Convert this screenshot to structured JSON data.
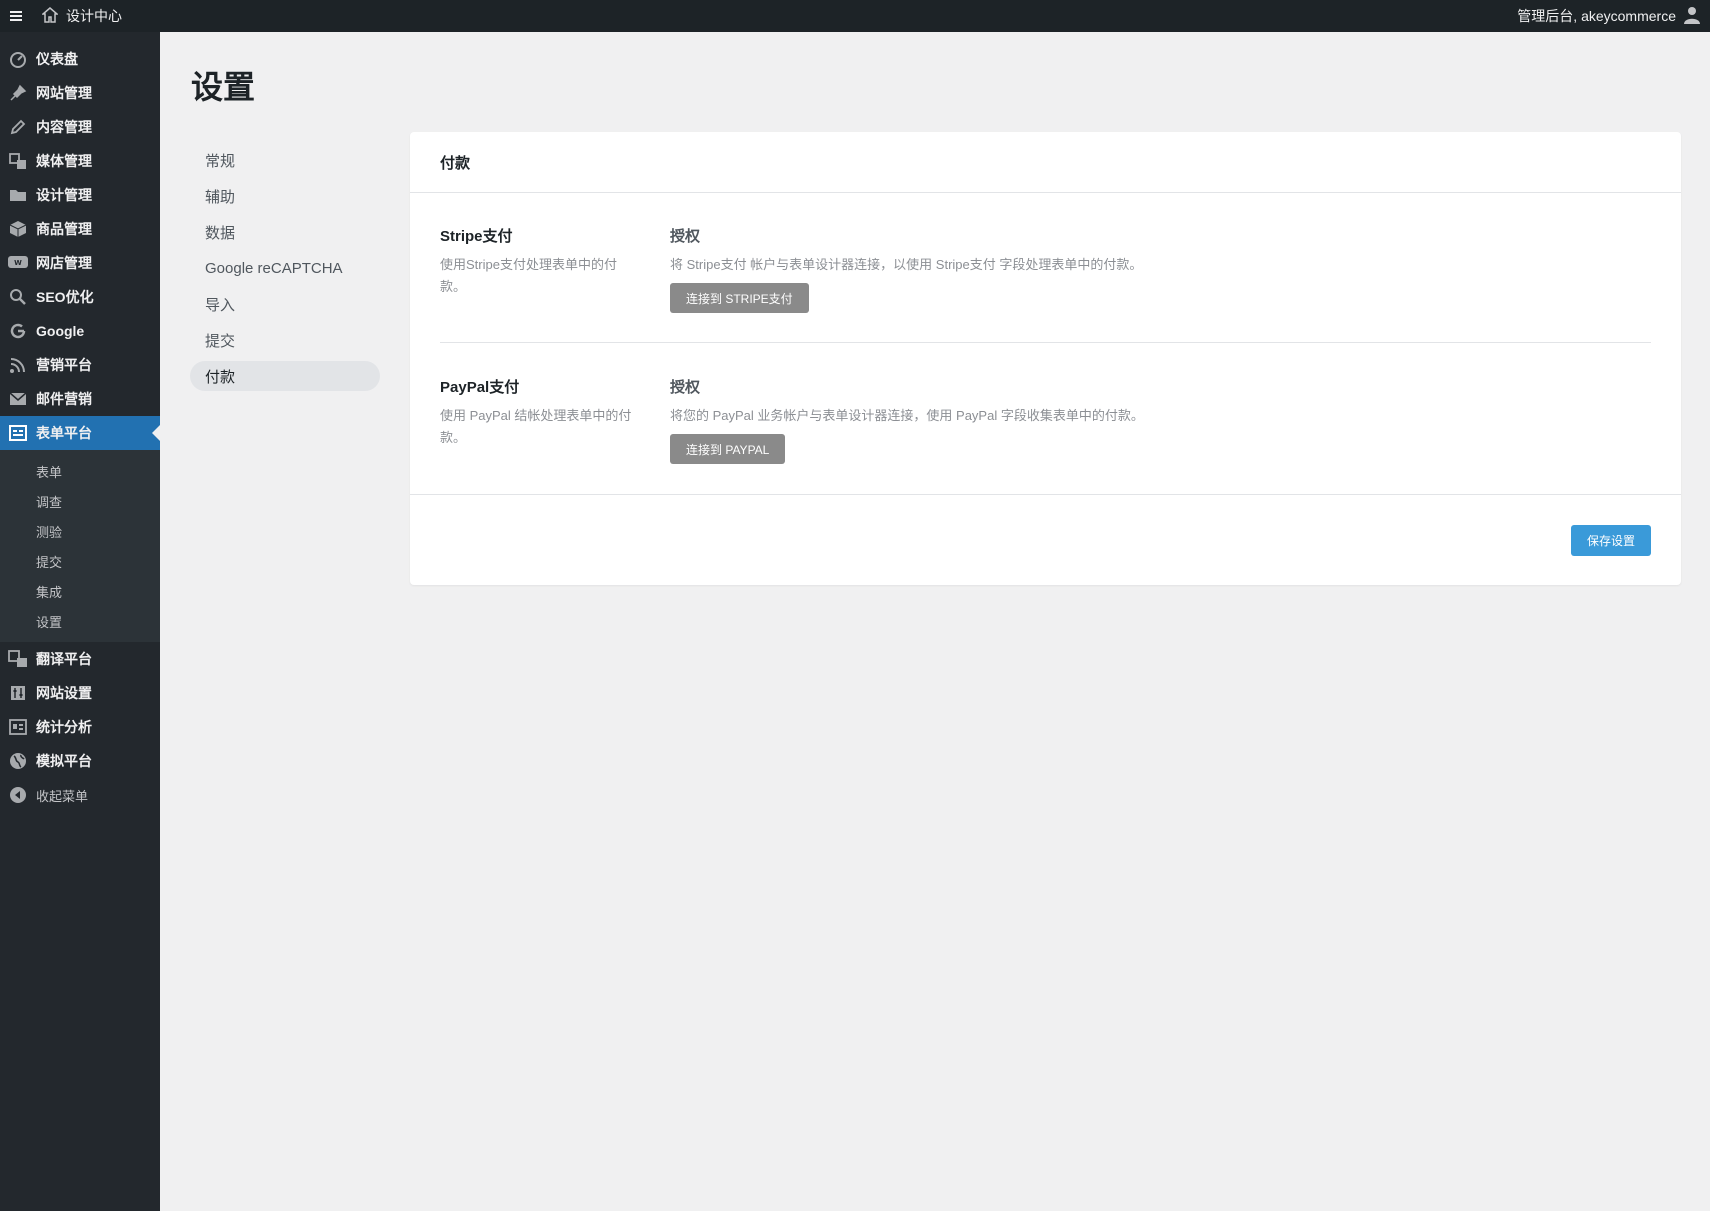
{
  "adminbar": {
    "site_title": "设计中心",
    "greeting": "管理后台, akeycommerce"
  },
  "sidebar": {
    "items": [
      {
        "label": "仪表盘",
        "icon": "dashboard-icon"
      },
      {
        "label": "网站管理",
        "icon": "pin-icon"
      },
      {
        "label": "内容管理",
        "icon": "pencil-icon"
      },
      {
        "label": "媒体管理",
        "icon": "media-icon"
      },
      {
        "label": "设计管理",
        "icon": "folder-icon"
      },
      {
        "label": "商品管理",
        "icon": "box-icon"
      },
      {
        "label": "网店管理",
        "icon": "woo-icon"
      },
      {
        "label": "SEO优化",
        "icon": "search-icon"
      },
      {
        "label": "Google",
        "icon": "google-icon"
      },
      {
        "label": "营销平台",
        "icon": "rss-icon"
      },
      {
        "label": "邮件营销",
        "icon": "mail-icon"
      },
      {
        "label": "表单平台",
        "icon": "form-icon",
        "active": true
      }
    ],
    "submenu": [
      "表单",
      "调查",
      "测验",
      "提交",
      "集成",
      "设置"
    ],
    "items_after": [
      {
        "label": "翻译平台",
        "icon": "translate-icon"
      },
      {
        "label": "网站设置",
        "icon": "settings-icon"
      },
      {
        "label": "统计分析",
        "icon": "analytics-icon"
      },
      {
        "label": "模拟平台",
        "icon": "globe-icon"
      }
    ],
    "collapse_label": "收起菜单"
  },
  "page": {
    "title": "设置"
  },
  "subnav": {
    "items": [
      "常规",
      "辅助",
      "数据",
      "Google reCAPTCHA",
      "导入",
      "提交",
      "付款"
    ],
    "active": "付款"
  },
  "card": {
    "header": "付款",
    "stripe": {
      "title": "Stripe支付",
      "desc": "使用Stripe支付处理表单中的付款。",
      "auth_title": "授权",
      "auth_desc": "将 Stripe支付 帐户与表单设计器连接，以使用 Stripe支付 字段处理表单中的付款。",
      "button": "连接到 STRIPE支付"
    },
    "paypal": {
      "title": "PayPal支付",
      "desc": "使用 PayPal 结帐处理表单中的付款。",
      "auth_title": "授权",
      "auth_desc": "将您的 PayPal 业务帐户与表单设计器连接，使用 PayPal 字段收集表单中的付款。",
      "button": "连接到 PAYPAL"
    },
    "save_button": "保存设置"
  },
  "colors": {
    "sidebar_bg": "#23282d",
    "active_menu": "#2271b1",
    "save_button": "#3a9ad9",
    "connect_button": "#8a8a8a"
  }
}
